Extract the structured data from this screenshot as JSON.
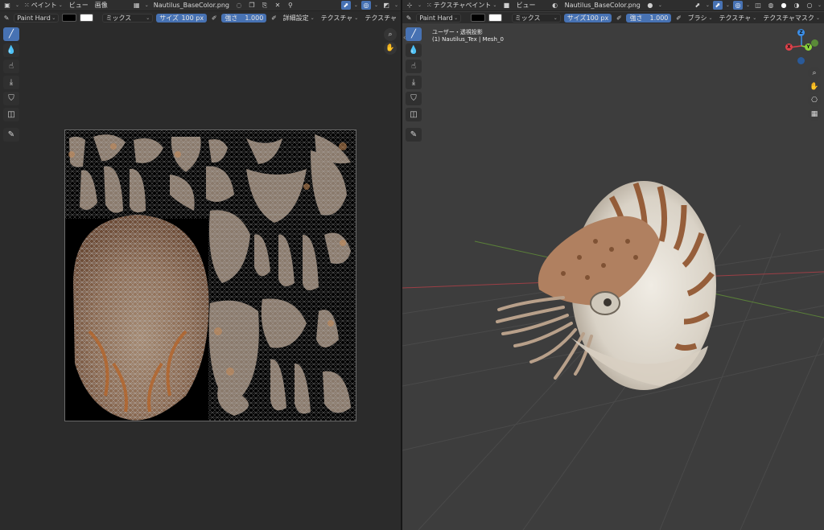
{
  "left": {
    "header": {
      "mode_label": "ペイント",
      "menus": [
        "ビュー",
        "画像"
      ],
      "image_name": "Nautilus_BaseColor.png"
    },
    "tool_header": {
      "brush_name": "Paint Hard",
      "blend_mode": "ミックス",
      "radius_label": "サイズ",
      "radius_value": "100 px",
      "strength_label": "強さ",
      "strength_value": "1.000",
      "advanced_label": "詳細設定",
      "texture_label": "テクスチャ",
      "texture_label_2": "テクスチャ"
    },
    "tools": [
      "draw-brush",
      "soften",
      "smear",
      "clone",
      "fill",
      "mask",
      "annotate"
    ]
  },
  "right": {
    "header": {
      "mode_label": "テクスチャペイント",
      "menu_view": "ビュー",
      "image_name": "Nautilus_BaseColor.png"
    },
    "tool_header": {
      "brush_name": "Paint Hard",
      "blend_mode": "ミックス",
      "radius_label": "サイズ",
      "radius_value": "100 px",
      "strength_label": "強さ",
      "strength_value": "1.000",
      "brush_menu": "ブラシ",
      "texture_menu": "テクスチャ",
      "texture_mask_menu": "テクスチャマスク"
    },
    "viewport": {
      "view_name": "ユーザー・透視投影",
      "object_info": "(1) Nautilus_Tex | Mesh_0"
    },
    "gizmo": {
      "x": "X",
      "y": "Y",
      "z": "Z"
    }
  },
  "colors": {
    "accent": "#4772b3",
    "background": "#2b2b2b",
    "viewport_bg": "#3d3d3d",
    "x_axis": "#e0414a",
    "y_axis": "#8bd43b",
    "z_axis": "#3b8ee8"
  }
}
